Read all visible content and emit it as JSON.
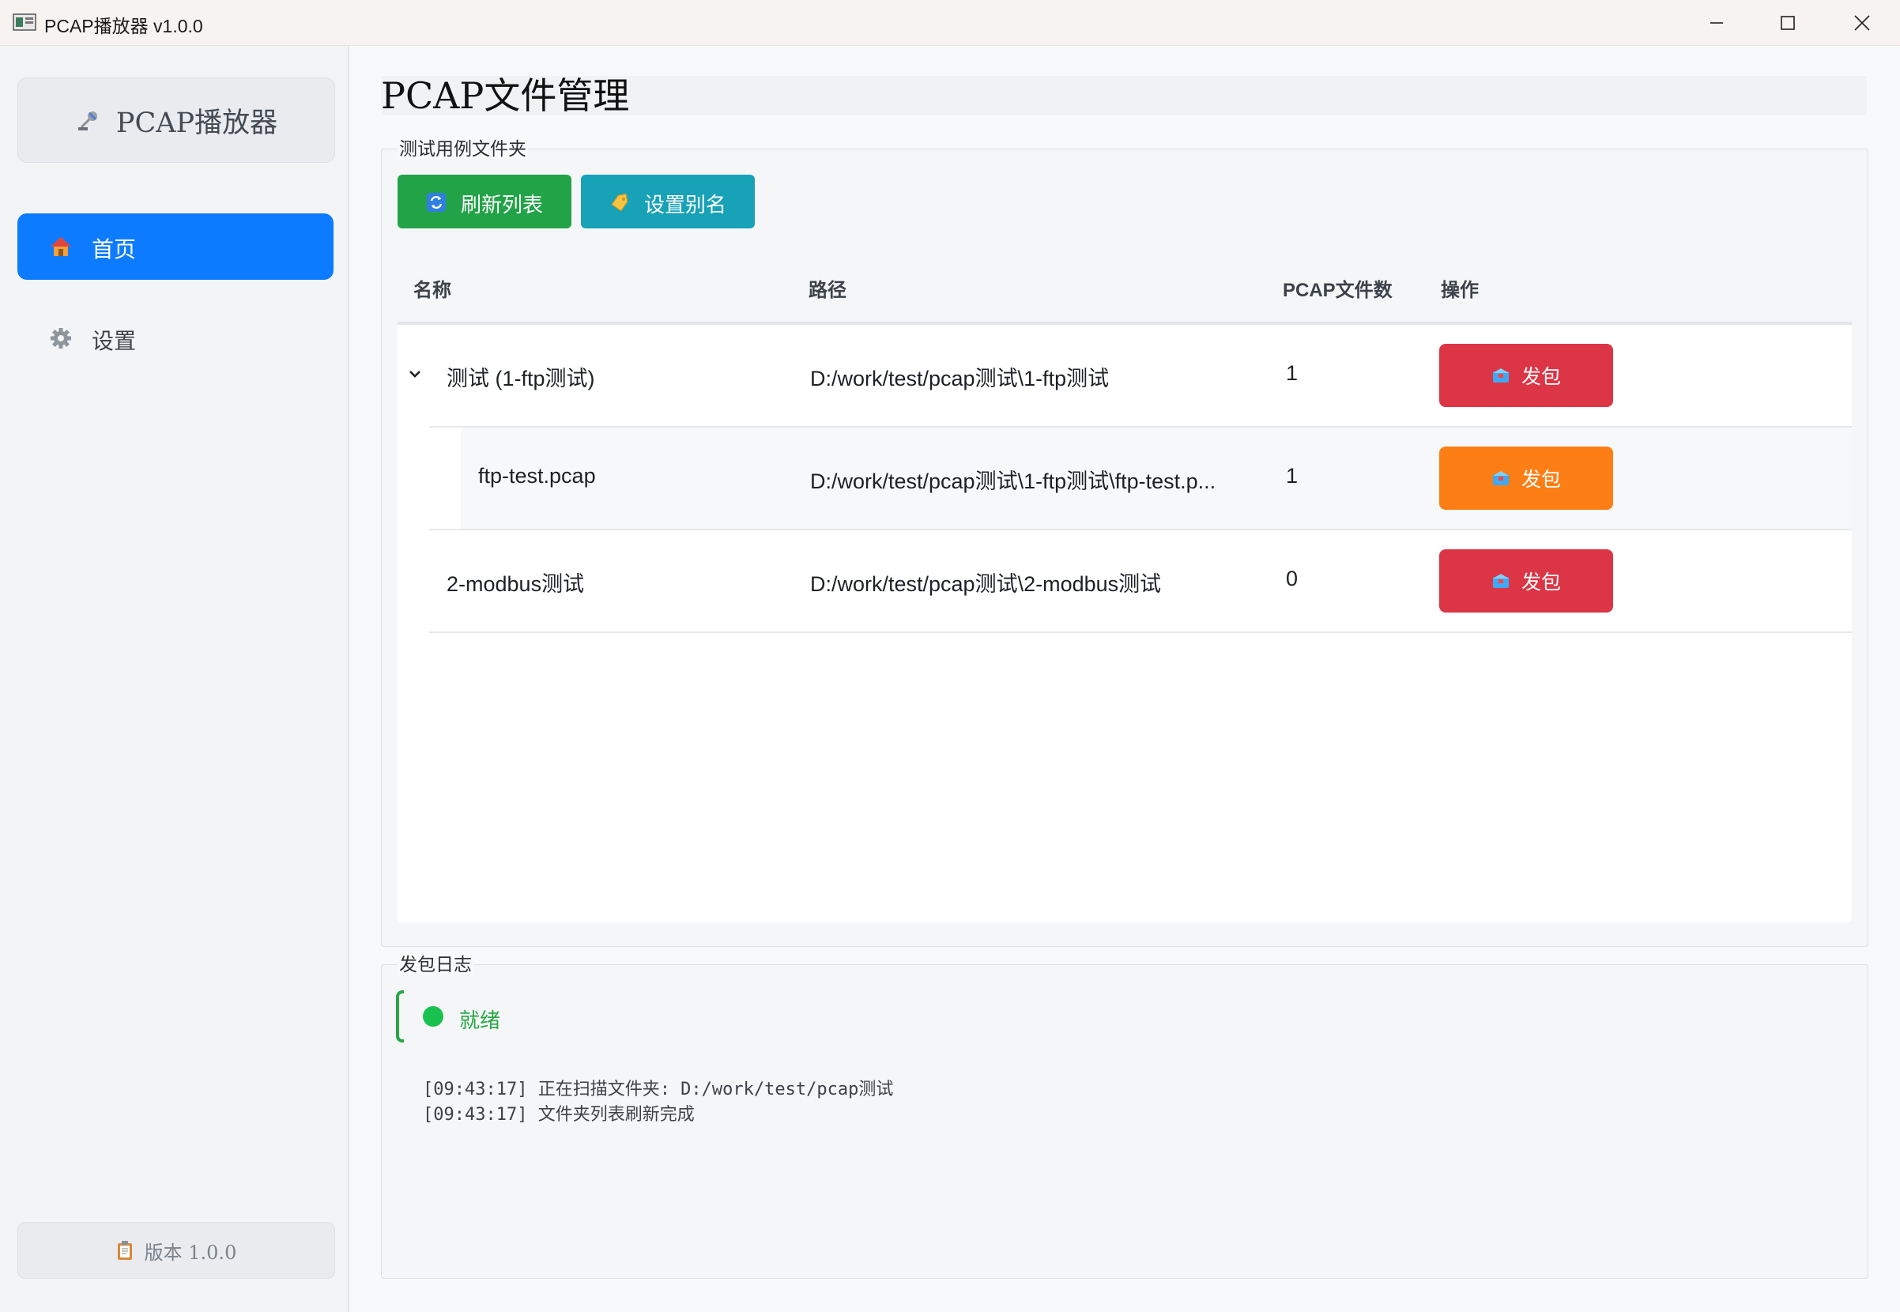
{
  "window": {
    "title": "PCAP播放器 v1.0.0",
    "controls": [
      "minimize-icon",
      "maximize-icon",
      "close-icon"
    ]
  },
  "sidebar": {
    "brand": {
      "icon": "satellite-icon",
      "label": "PCAP播放器"
    },
    "nav": [
      {
        "icon": "house-icon",
        "label": "首页",
        "active": true
      },
      {
        "icon": "gear-icon",
        "label": "设置",
        "active": false
      }
    ],
    "version": {
      "icon": "clipboard-icon",
      "label": "版本 1.0.0"
    }
  },
  "main": {
    "title": "PCAP文件管理",
    "folders_group": {
      "legend": "测试用例文件夹",
      "buttons": {
        "refresh": {
          "icon": "refresh-icon",
          "label": "刷新列表"
        },
        "alias": {
          "icon": "tag-icon",
          "label": "设置别名"
        }
      },
      "table": {
        "headers": {
          "name": "名称",
          "path": "路径",
          "count": "PCAP文件数",
          "action": "操作"
        },
        "rows": [
          {
            "name": "测试 (1-ftp测试)",
            "path": "D:/work/test/pcap测试\\1-ftp测试",
            "count": "1",
            "action": "发包",
            "expanded": true,
            "level": 0
          },
          {
            "name": "ftp-test.pcap",
            "path": "D:/work/test/pcap测试\\1-ftp测试\\ftp-test.p...",
            "count": "1",
            "action": "发包",
            "level": 1
          },
          {
            "name": "2-modbus测试",
            "path": "D:/work/test/pcap测试\\2-modbus测试",
            "count": "0",
            "action": "发包",
            "level": 0
          }
        ]
      }
    },
    "log_group": {
      "legend": "发包日志",
      "status": "就绪",
      "lines": [
        "[09:43:17] 正在扫描文件夹: D:/work/test/pcap测试",
        "[09:43:17] 文件夹列表刷新完成"
      ]
    }
  },
  "colors": {
    "primary": "#0d7bff",
    "success": "#22a348",
    "info": "#17a2b8",
    "danger": "#dc3545",
    "warning": "#fd7e14"
  }
}
